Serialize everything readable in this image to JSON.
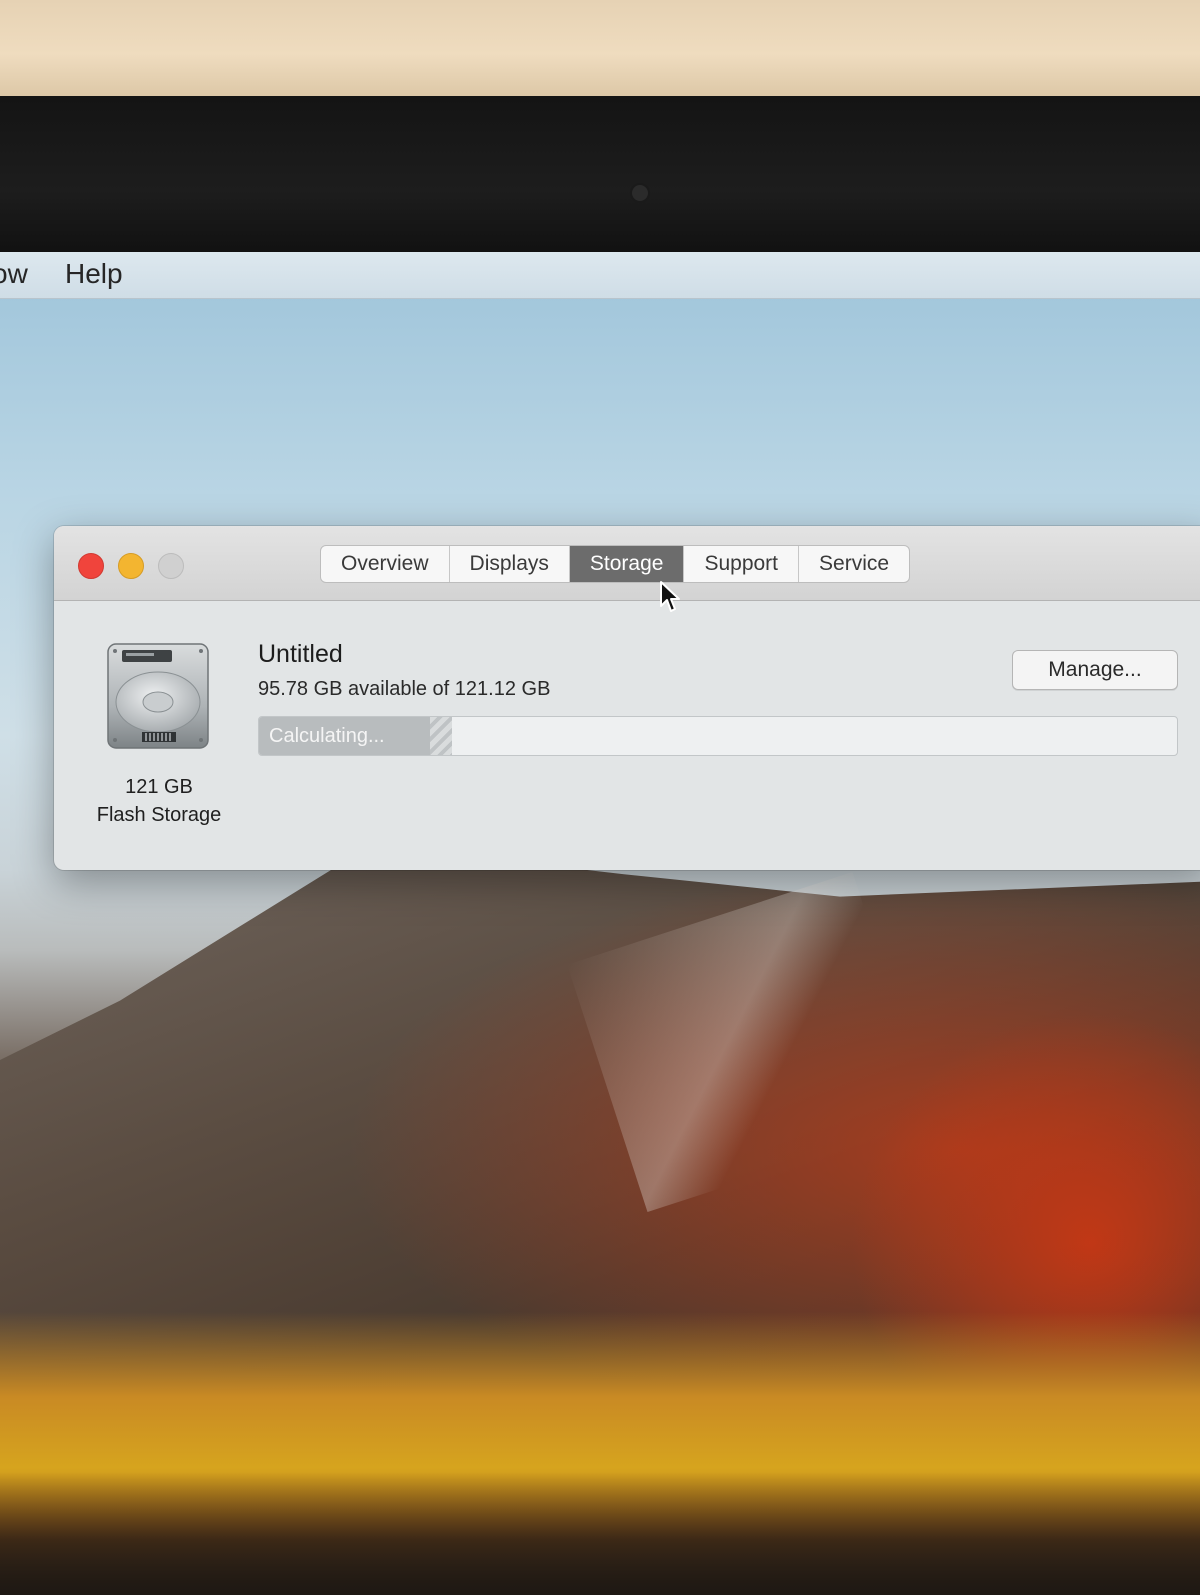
{
  "menubar": {
    "items": [
      "ow",
      "Help"
    ]
  },
  "window": {
    "tabs": [
      {
        "label": "Overview",
        "active": false
      },
      {
        "label": "Displays",
        "active": false
      },
      {
        "label": "Storage",
        "active": true
      },
      {
        "label": "Support",
        "active": false
      },
      {
        "label": "Service",
        "active": false
      }
    ],
    "storage": {
      "disk_size": "121 GB",
      "disk_type": "Flash Storage",
      "volume_name": "Untitled",
      "availability": "95.78 GB available of 121.12 GB",
      "manage_label": "Manage...",
      "usage_status": "Calculating...",
      "used_fraction": 0.21
    }
  },
  "colors": {
    "close": "#f0443c",
    "minimize": "#f3b530",
    "zoom_disabled": "#d0d0d0",
    "active_tab": "#6c6c6c"
  },
  "icons": [
    "hard-drive-icon",
    "arrow-cursor-icon"
  ]
}
